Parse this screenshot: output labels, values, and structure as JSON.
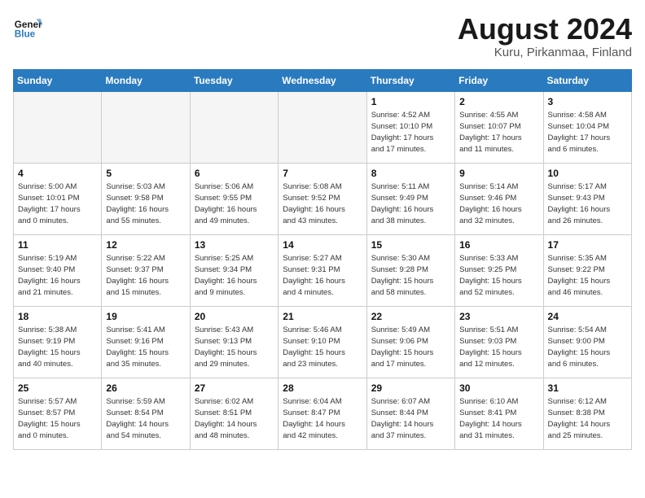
{
  "header": {
    "logo_line1": "General",
    "logo_line2": "Blue",
    "month_title": "August 2024",
    "location": "Kuru, Pirkanmaa, Finland"
  },
  "days_of_week": [
    "Sunday",
    "Monday",
    "Tuesday",
    "Wednesday",
    "Thursday",
    "Friday",
    "Saturday"
  ],
  "weeks": [
    [
      {
        "num": "",
        "info": ""
      },
      {
        "num": "",
        "info": ""
      },
      {
        "num": "",
        "info": ""
      },
      {
        "num": "",
        "info": ""
      },
      {
        "num": "1",
        "info": "Sunrise: 4:52 AM\nSunset: 10:10 PM\nDaylight: 17 hours\nand 17 minutes."
      },
      {
        "num": "2",
        "info": "Sunrise: 4:55 AM\nSunset: 10:07 PM\nDaylight: 17 hours\nand 11 minutes."
      },
      {
        "num": "3",
        "info": "Sunrise: 4:58 AM\nSunset: 10:04 PM\nDaylight: 17 hours\nand 6 minutes."
      }
    ],
    [
      {
        "num": "4",
        "info": "Sunrise: 5:00 AM\nSunset: 10:01 PM\nDaylight: 17 hours\nand 0 minutes."
      },
      {
        "num": "5",
        "info": "Sunrise: 5:03 AM\nSunset: 9:58 PM\nDaylight: 16 hours\nand 55 minutes."
      },
      {
        "num": "6",
        "info": "Sunrise: 5:06 AM\nSunset: 9:55 PM\nDaylight: 16 hours\nand 49 minutes."
      },
      {
        "num": "7",
        "info": "Sunrise: 5:08 AM\nSunset: 9:52 PM\nDaylight: 16 hours\nand 43 minutes."
      },
      {
        "num": "8",
        "info": "Sunrise: 5:11 AM\nSunset: 9:49 PM\nDaylight: 16 hours\nand 38 minutes."
      },
      {
        "num": "9",
        "info": "Sunrise: 5:14 AM\nSunset: 9:46 PM\nDaylight: 16 hours\nand 32 minutes."
      },
      {
        "num": "10",
        "info": "Sunrise: 5:17 AM\nSunset: 9:43 PM\nDaylight: 16 hours\nand 26 minutes."
      }
    ],
    [
      {
        "num": "11",
        "info": "Sunrise: 5:19 AM\nSunset: 9:40 PM\nDaylight: 16 hours\nand 21 minutes."
      },
      {
        "num": "12",
        "info": "Sunrise: 5:22 AM\nSunset: 9:37 PM\nDaylight: 16 hours\nand 15 minutes."
      },
      {
        "num": "13",
        "info": "Sunrise: 5:25 AM\nSunset: 9:34 PM\nDaylight: 16 hours\nand 9 minutes."
      },
      {
        "num": "14",
        "info": "Sunrise: 5:27 AM\nSunset: 9:31 PM\nDaylight: 16 hours\nand 4 minutes."
      },
      {
        "num": "15",
        "info": "Sunrise: 5:30 AM\nSunset: 9:28 PM\nDaylight: 15 hours\nand 58 minutes."
      },
      {
        "num": "16",
        "info": "Sunrise: 5:33 AM\nSunset: 9:25 PM\nDaylight: 15 hours\nand 52 minutes."
      },
      {
        "num": "17",
        "info": "Sunrise: 5:35 AM\nSunset: 9:22 PM\nDaylight: 15 hours\nand 46 minutes."
      }
    ],
    [
      {
        "num": "18",
        "info": "Sunrise: 5:38 AM\nSunset: 9:19 PM\nDaylight: 15 hours\nand 40 minutes."
      },
      {
        "num": "19",
        "info": "Sunrise: 5:41 AM\nSunset: 9:16 PM\nDaylight: 15 hours\nand 35 minutes."
      },
      {
        "num": "20",
        "info": "Sunrise: 5:43 AM\nSunset: 9:13 PM\nDaylight: 15 hours\nand 29 minutes."
      },
      {
        "num": "21",
        "info": "Sunrise: 5:46 AM\nSunset: 9:10 PM\nDaylight: 15 hours\nand 23 minutes."
      },
      {
        "num": "22",
        "info": "Sunrise: 5:49 AM\nSunset: 9:06 PM\nDaylight: 15 hours\nand 17 minutes."
      },
      {
        "num": "23",
        "info": "Sunrise: 5:51 AM\nSunset: 9:03 PM\nDaylight: 15 hours\nand 12 minutes."
      },
      {
        "num": "24",
        "info": "Sunrise: 5:54 AM\nSunset: 9:00 PM\nDaylight: 15 hours\nand 6 minutes."
      }
    ],
    [
      {
        "num": "25",
        "info": "Sunrise: 5:57 AM\nSunset: 8:57 PM\nDaylight: 15 hours\nand 0 minutes."
      },
      {
        "num": "26",
        "info": "Sunrise: 5:59 AM\nSunset: 8:54 PM\nDaylight: 14 hours\nand 54 minutes."
      },
      {
        "num": "27",
        "info": "Sunrise: 6:02 AM\nSunset: 8:51 PM\nDaylight: 14 hours\nand 48 minutes."
      },
      {
        "num": "28",
        "info": "Sunrise: 6:04 AM\nSunset: 8:47 PM\nDaylight: 14 hours\nand 42 minutes."
      },
      {
        "num": "29",
        "info": "Sunrise: 6:07 AM\nSunset: 8:44 PM\nDaylight: 14 hours\nand 37 minutes."
      },
      {
        "num": "30",
        "info": "Sunrise: 6:10 AM\nSunset: 8:41 PM\nDaylight: 14 hours\nand 31 minutes."
      },
      {
        "num": "31",
        "info": "Sunrise: 6:12 AM\nSunset: 8:38 PM\nDaylight: 14 hours\nand 25 minutes."
      }
    ]
  ]
}
